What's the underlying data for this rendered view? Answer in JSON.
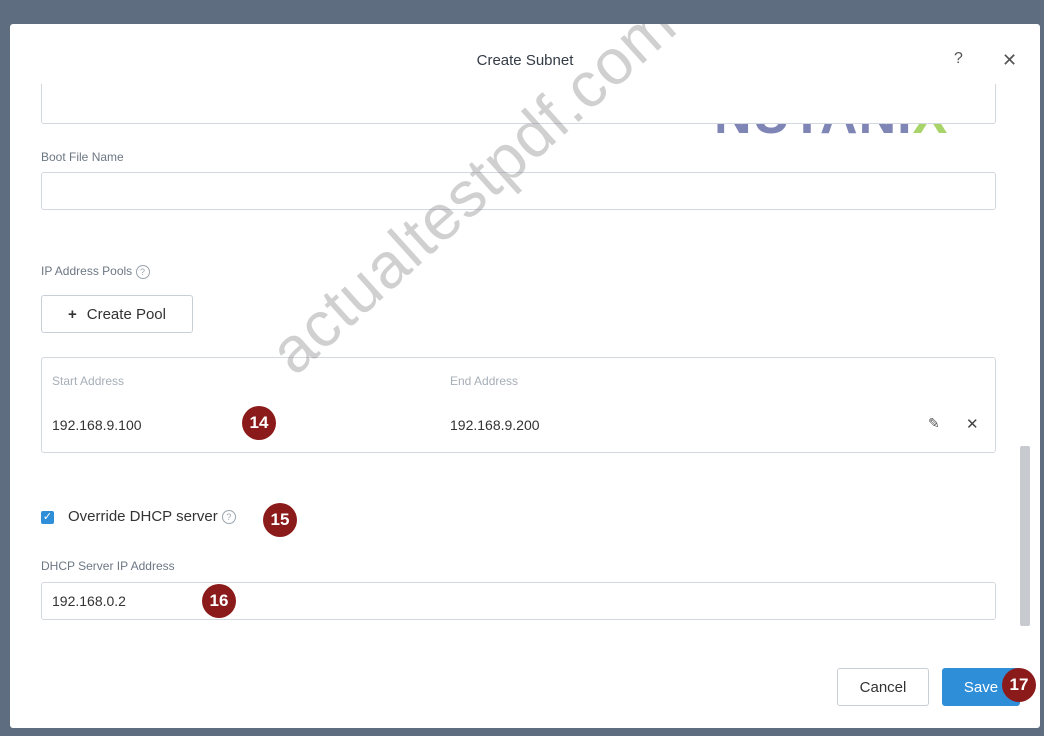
{
  "dialog": {
    "title": "Create Subnet",
    "help_label": "?",
    "close_label": "✕"
  },
  "logo": {
    "text": "NUTANI",
    "x_glyph": "X",
    "brand_color": "#7f85b5",
    "accent_color": "#a8d46a"
  },
  "boot_file": {
    "label": "Boot File Name",
    "value": ""
  },
  "ip_pools": {
    "label": "IP Address Pools",
    "help_glyph": "?",
    "create_pool_label": "Create Pool",
    "create_pool_icon": "+",
    "start_header": "Start Address",
    "end_header": "End Address",
    "rows": [
      {
        "start": "192.168.9.100",
        "end": "192.168.9.200"
      }
    ],
    "edit_icon": "✎",
    "remove_icon": "✕"
  },
  "override_dhcp": {
    "checked": true,
    "check_glyph": "✓",
    "label": "Override DHCP server",
    "help_glyph": "?"
  },
  "dhcp_server": {
    "label": "DHCP Server IP Address",
    "value": "192.168.0.2"
  },
  "badges": {
    "b14": "14",
    "b15": "15",
    "b16": "16",
    "b17": "17"
  },
  "footer": {
    "cancel_label": "Cancel",
    "save_label": "Save"
  },
  "watermark": "actualtestpdf.com",
  "colors": {
    "badge": "#8b1a1a",
    "primary": "#2e8fd8",
    "checkbox": "#2e8fd8"
  }
}
